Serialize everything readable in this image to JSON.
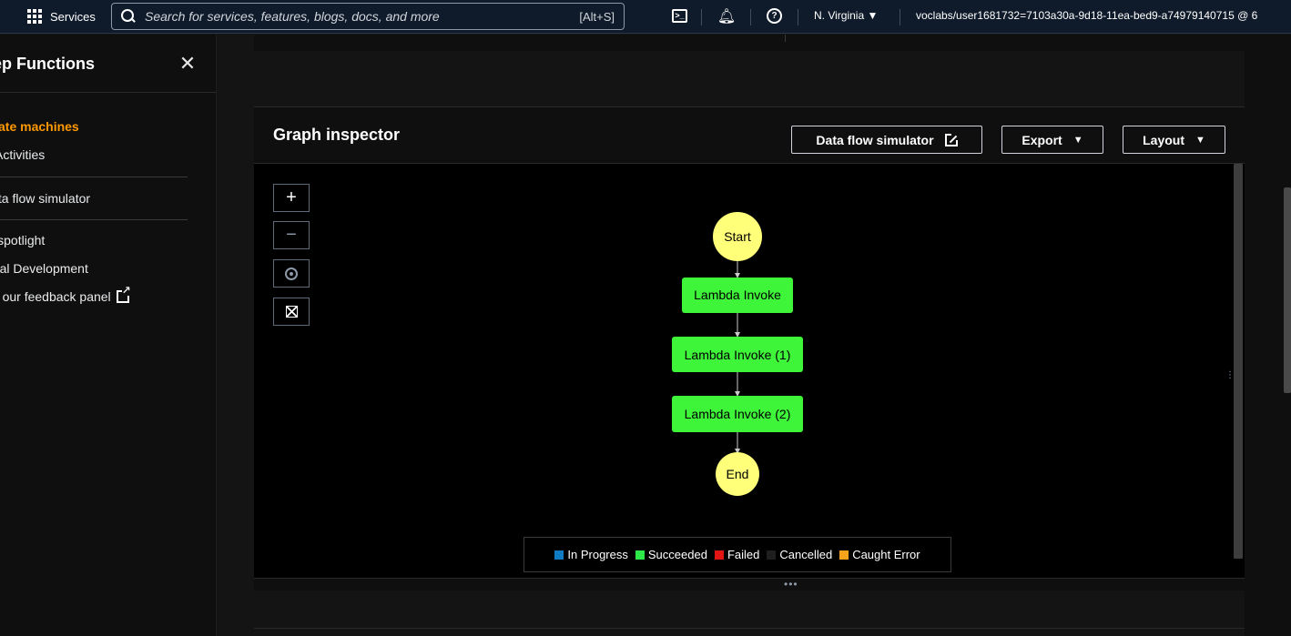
{
  "topnav": {
    "services_label": "Services",
    "search_placeholder": "Search for services, features, blogs, docs, and more",
    "search_shortcut": "[Alt+S]",
    "region": "N. Virginia ▼",
    "account": "voclabs/user1681732=7103a30a-9d18-11ea-bed9-a74979140715 @ 6"
  },
  "sidebar": {
    "title": "Step Functions",
    "items": [
      {
        "label": "State machines",
        "active": true
      },
      {
        "label": "Activities"
      },
      {
        "label": "Data flow simulator"
      },
      {
        "label": "Feature spotlight"
      },
      {
        "label": "Local Development"
      },
      {
        "label": "Join our feedback panel"
      }
    ]
  },
  "graph_inspector": {
    "title": "Graph inspector",
    "buttons": {
      "data_flow_simulator": "Data flow simulator",
      "export": "Export",
      "layout": "Layout"
    },
    "nodes": [
      {
        "id": "start",
        "label": "Start",
        "kind": "terminal"
      },
      {
        "id": "lambda0",
        "label": "Lambda Invoke",
        "kind": "task",
        "status": "Succeeded"
      },
      {
        "id": "lambda1",
        "label": "Lambda Invoke (1)",
        "kind": "task",
        "status": "Succeeded"
      },
      {
        "id": "lambda2",
        "label": "Lambda Invoke (2)",
        "kind": "task",
        "status": "Succeeded"
      },
      {
        "id": "end",
        "label": "End",
        "kind": "terminal"
      }
    ],
    "legend": [
      {
        "label": "In Progress",
        "color": "#0f7bc2"
      },
      {
        "label": "Succeeded",
        "color": "#2ee84a"
      },
      {
        "label": "Failed",
        "color": "#e31414"
      },
      {
        "label": "Cancelled",
        "color": "#1f1f1f"
      },
      {
        "label": "Caught Error",
        "color": "#f7a21b"
      }
    ],
    "colors": {
      "terminal": "#ffff7a",
      "task": "#3ef53a",
      "edge": "#c9c9c9"
    }
  }
}
